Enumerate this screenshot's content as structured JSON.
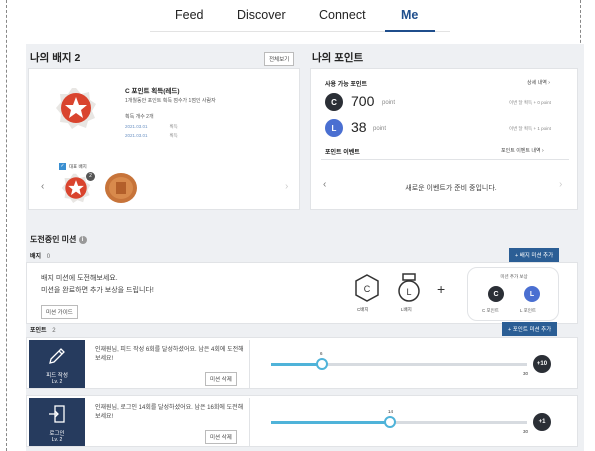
{
  "nav": {
    "tabs": [
      "Feed",
      "Discover",
      "Connect",
      "Me"
    ],
    "active": "Me"
  },
  "badges": {
    "title": "나의 배지",
    "count": "2",
    "view_all": "전체보기",
    "featured": {
      "name": "C 포인트 획득(레드)",
      "desc": "1개월동안 포인트 획득 점수가 1점인 사람자",
      "earned_label": "획득 개수 2개",
      "history": [
        {
          "date": "2021.03.01",
          "label": "획득"
        },
        {
          "date": "2021.03.01",
          "label": "획득"
        }
      ],
      "rep_label": "대표 배지"
    }
  },
  "points": {
    "title": "나의 포인트",
    "available_label": "사용 가능 포인트",
    "detail_link": "상세 내역",
    "c_points": {
      "letter": "C",
      "value": "700",
      "unit": "point",
      "note": "이번 달 획득 + 0 point"
    },
    "l_points": {
      "letter": "L",
      "value": "38",
      "unit": "point",
      "note": "이번 달 획득 + 1 point"
    },
    "event_label": "포인트 이벤트",
    "event_link": "포인트 이벤트 내역",
    "event_empty": "새로운 이벤트가 준비 중입니다."
  },
  "missions": {
    "title": "도전중인 미션",
    "badge_section": {
      "label": "배지",
      "count": "0",
      "add_button": "+ 배지 미션 추가"
    },
    "empty_text_1": "배지 미션에 도전해보세요.",
    "empty_text_2": "미션을 완료하면 추가 보상을 드립니다!",
    "guide_button": "미션 가이드",
    "badge_c_label": "C배지",
    "badge_l_label": "L배지",
    "plus_sign": "+",
    "extra_reward": {
      "title": "미션 추가 보상",
      "c_label": "C 포인트",
      "l_label": "L 포인트"
    },
    "point_section": {
      "label": "포인트",
      "count": "2",
      "add_button": "+ 포인트 미션 추가"
    },
    "rows": [
      {
        "tile_name": "피드 작성",
        "tile_level": "Lv. 2",
        "text": "인재원님, 피드 작성 6회를 달성하셨어요. 남은 4회에 도전해보세요!",
        "delete": "미션 삭제",
        "progress": 6,
        "max": 30,
        "current_label": "6",
        "max_label": "30",
        "reward": "+10"
      },
      {
        "tile_name": "로그인",
        "tile_level": "Lv. 2",
        "text": "인재원님, 로그인 14회를 달성하셨어요. 남은 16회에 도전해보세요!",
        "delete": "미션 삭제",
        "progress": 14,
        "max": 30,
        "current_label": "14",
        "max_label": "30",
        "reward": "+1"
      }
    ]
  },
  "colors": {
    "accent": "#2b5e95",
    "navy_tile": "#263b5e",
    "slider": "#4fb3d9",
    "badge_red": "#d9442e",
    "badge_bronze": "#c7743a",
    "coin_dark": "#2b2f36",
    "coin_blue": "#4a6fd1"
  }
}
